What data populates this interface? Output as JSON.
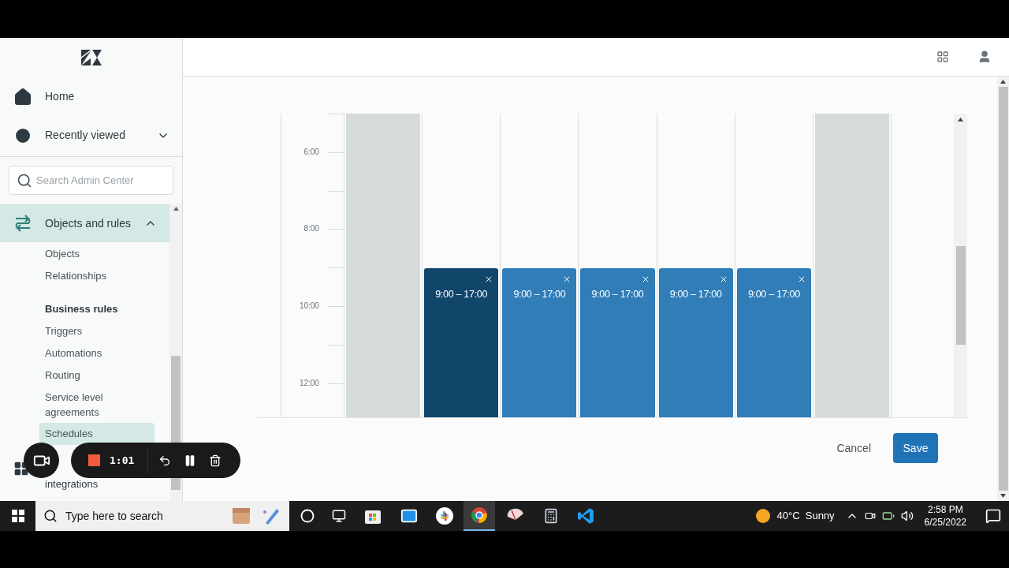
{
  "sidebar": {
    "nav": [
      {
        "kind": "home",
        "label": "Home"
      },
      {
        "kind": "recent",
        "label": "Recently viewed",
        "expanded": false
      }
    ],
    "search": {
      "placeholder": "Search Admin Center"
    },
    "section": {
      "label": "Objects and rules",
      "expanded": true,
      "groups": [
        {
          "items": [
            {
              "label": "Objects",
              "selected": false
            },
            {
              "label": "Relationships",
              "selected": false
            }
          ]
        },
        {
          "heading": "Business rules",
          "items": [
            {
              "label": "Triggers",
              "selected": false
            },
            {
              "label": "Automations",
              "selected": false
            },
            {
              "label": "Routing",
              "selected": false
            },
            {
              "label": "Service level agreements",
              "selected": false
            },
            {
              "label": "Schedules",
              "selected": true
            }
          ]
        }
      ]
    },
    "next_section": {
      "label": "integrations"
    }
  },
  "calendar": {
    "time_labels": [
      "6:00",
      "8:00",
      "10:00",
      "12:00"
    ],
    "days": [
      {
        "kind": "closed"
      },
      {
        "kind": "hours",
        "label": "9:00 – 17:00",
        "selected": true
      },
      {
        "kind": "hours",
        "label": "9:00 – 17:00",
        "selected": false
      },
      {
        "kind": "hours",
        "label": "9:00 – 17:00",
        "selected": false
      },
      {
        "kind": "hours",
        "label": "9:00 – 17:00",
        "selected": false
      },
      {
        "kind": "hours",
        "label": "9:00 – 17:00",
        "selected": false
      },
      {
        "kind": "closed"
      }
    ]
  },
  "footer": {
    "cancel": "Cancel",
    "save": "Save"
  },
  "recorder": {
    "time": "1:01"
  },
  "taskbar": {
    "search_placeholder": "Type here to search",
    "weather": "40°C  Sunny",
    "time": "2:58 PM",
    "date": "6/25/2022"
  }
}
